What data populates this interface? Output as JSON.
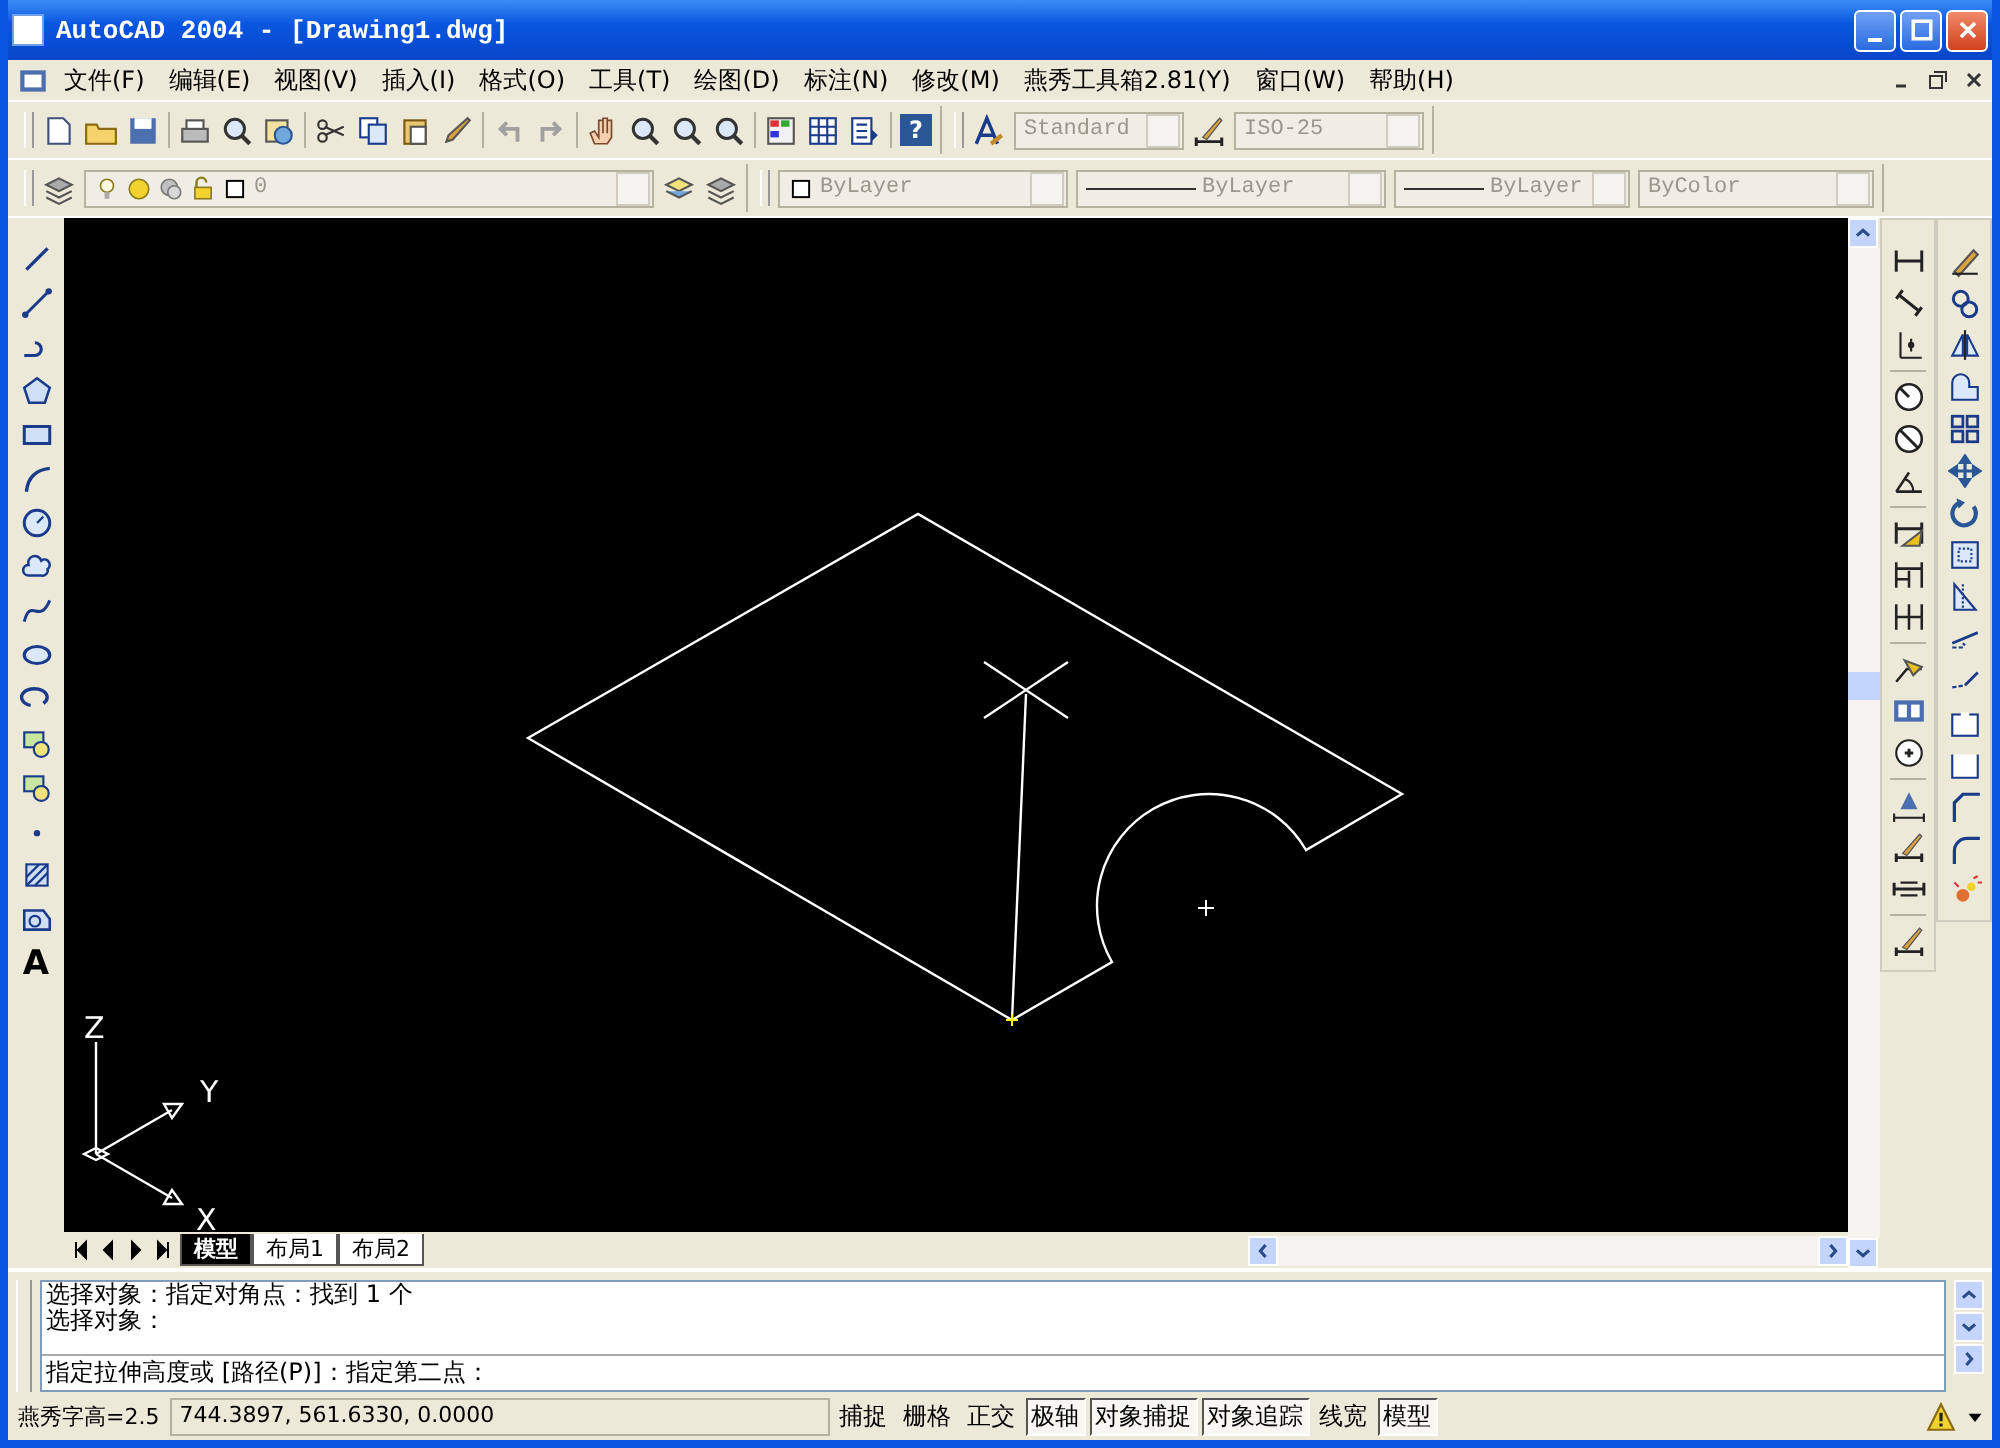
{
  "window": {
    "title": "AutoCAD 2004 - [Drawing1.dwg]"
  },
  "menu": [
    "文件(F)",
    "编辑(E)",
    "视图(V)",
    "插入(I)",
    "格式(O)",
    "工具(T)",
    "绘图(D)",
    "标注(N)",
    "修改(M)",
    "燕秀工具箱2.81(Y)",
    "窗口(W)",
    "帮助(H)"
  ],
  "toolbars": {
    "help_glyph": "?",
    "text_style": "Standard",
    "dim_style": "ISO-25",
    "layer": "0",
    "color_control": "ByLayer",
    "linetype": "ByLayer",
    "lineweight": "ByLayer",
    "plot_style": "ByColor"
  },
  "draw_toolbar": {
    "text_glyph": "A"
  },
  "canvas": {
    "ucs_labels": {
      "z": "Z",
      "y": "Y",
      "x": "X"
    }
  },
  "layout_tabs": [
    {
      "label": "模型",
      "selected": true
    },
    {
      "label": "布局1",
      "selected": false
    },
    {
      "label": "布局2",
      "selected": false
    }
  ],
  "command": {
    "history": [
      "选择对象：指定对角点：找到 1 个",
      "选择对象："
    ],
    "prompt": "指定拉伸高度或 [路径(P)]：指定第二点："
  },
  "status_bar": {
    "label": "燕秀字高=2.5",
    "coordinates": "744.3897, 561.6330, 0.0000",
    "toggles": [
      {
        "label": "捕捉",
        "on": false
      },
      {
        "label": "栅格",
        "on": false
      },
      {
        "label": "正交",
        "on": false
      },
      {
        "label": "极轴",
        "on": true
      },
      {
        "label": "对象捕捉",
        "on": true
      },
      {
        "label": "对象追踪",
        "on": true
      },
      {
        "label": "线宽",
        "on": false
      },
      {
        "label": "模型",
        "on": true
      }
    ]
  }
}
